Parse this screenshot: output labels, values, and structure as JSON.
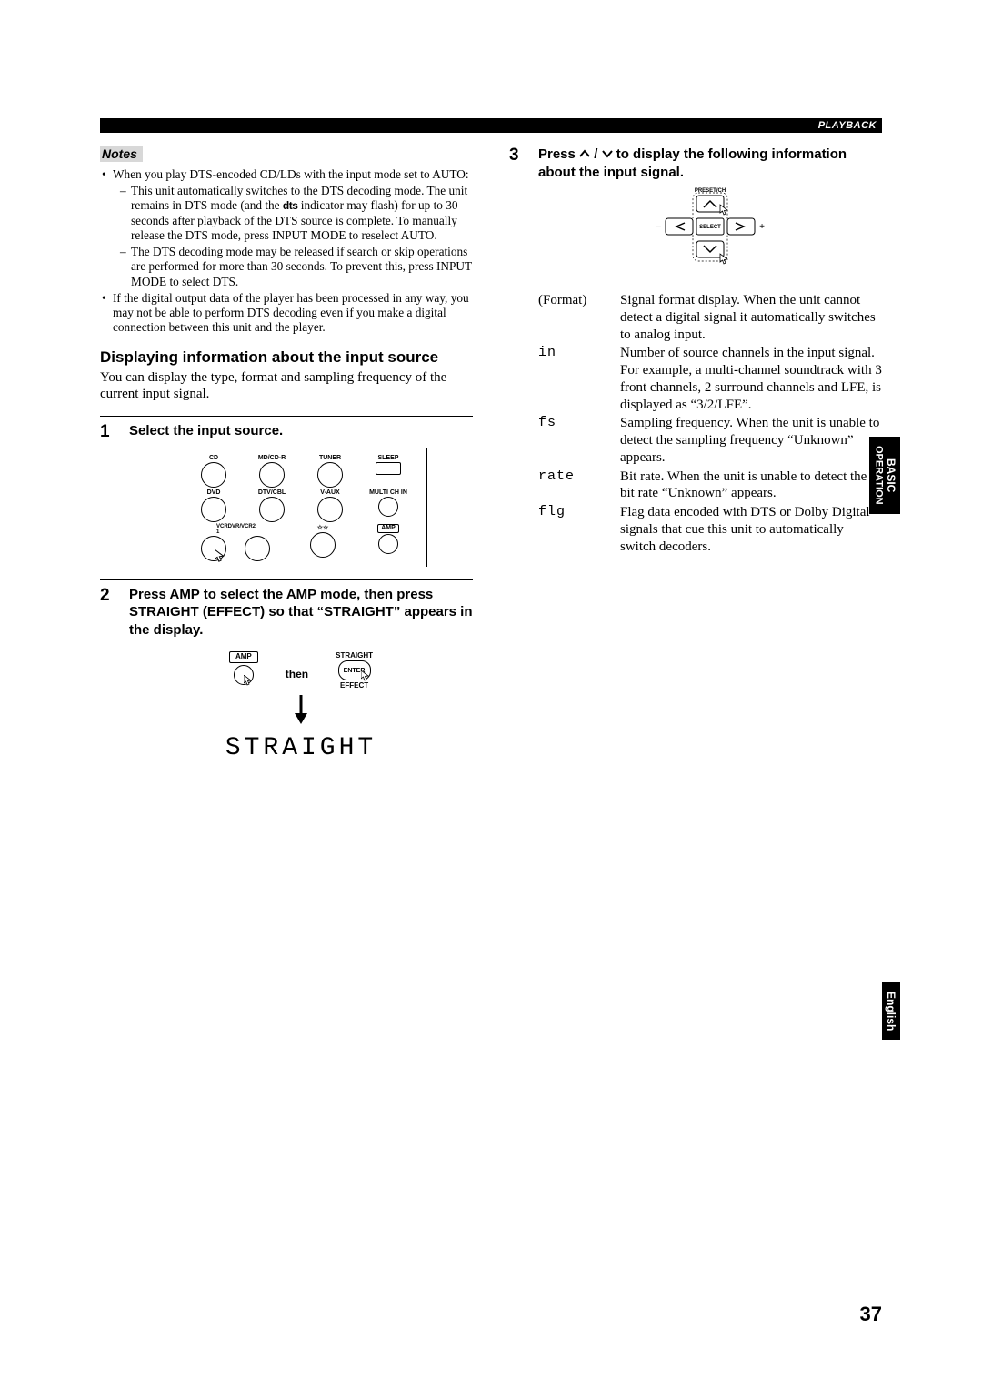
{
  "header": {
    "breadcrumb": "PLAYBACK"
  },
  "notes": {
    "label": "Notes",
    "b1_lead": "When you play DTS-encoded CD/LDs with the input mode set to AUTO:",
    "b1_d1a": "This unit automatically switches to the DTS decoding mode. The unit remains in DTS mode (and the ",
    "b1_d1_dts": "dts",
    "b1_d1b": " indicator may flash) for up to 30 seconds after playback of the DTS source is complete. To manually release the DTS mode, press INPUT MODE to reselect AUTO.",
    "b1_d2": "The DTS decoding mode may be released if search or skip operations are performed for more than 30 seconds. To prevent this, press INPUT MODE to select DTS.",
    "b2": "If the digital output data of the player has been processed in any way, you may not be able to perform DTS decoding even if you make a digital connection between this unit and the player."
  },
  "section": {
    "title": "Displaying information about the input source",
    "intro": "You can display the type, format and sampling frequency of the current input signal."
  },
  "step1": {
    "num": "1",
    "head": "Select the input source.",
    "labels": {
      "r1": [
        "CD",
        "MD/CD-R",
        "TUNER",
        "SLEEP"
      ],
      "r2": [
        "DVD",
        "DTV/CBL",
        "V-AUX",
        "MULTI CH IN"
      ],
      "r3_left": "VCR 1",
      "r3_mid": "DVR/VCR2",
      "r3_stars": "☆☆",
      "r3_amp": "AMP"
    }
  },
  "step2": {
    "num": "2",
    "head": "Press AMP to select the AMP mode, then press STRAIGHT (EFFECT) so that “STRAIGHT” appears in the display.",
    "amp_label": "AMP",
    "then": "then",
    "straight_top": "STRAIGHT",
    "straight_enter": "ENTER",
    "straight_bottom": "EFFECT",
    "readout": "STRAIGHT"
  },
  "step3": {
    "num": "3",
    "head_a": "Press ",
    "head_b": " to display the following information about the input signal.",
    "andor": " / ",
    "dpad": {
      "top": "PRESET/CH",
      "mid": "SELECT",
      "minus": "–",
      "plus": "+"
    },
    "rows": [
      {
        "key": "(Format)",
        "roman": true,
        "val": "Signal format display. When the unit cannot detect a digital signal it automatically switches to analog input."
      },
      {
        "key": "in",
        "val": "Number of source channels in the input signal. For example, a multi-channel soundtrack with 3 front channels, 2 surround channels and LFE, is displayed as “3/2/LFE”."
      },
      {
        "key": "fs",
        "val": "Sampling frequency. When the unit is unable to detect the sampling frequency “Unknown” appears."
      },
      {
        "key": "rate",
        "val": "Bit rate. When the unit is unable to detect the bit rate “Unknown” appears."
      },
      {
        "key": "flg",
        "val": "Flag data encoded with DTS or Dolby Digital signals that cue this unit to automatically switch decoders."
      }
    ]
  },
  "sidetabs": {
    "op1": "BASIC",
    "op2": "OPERATION",
    "lang": "English"
  },
  "page_number": "37"
}
